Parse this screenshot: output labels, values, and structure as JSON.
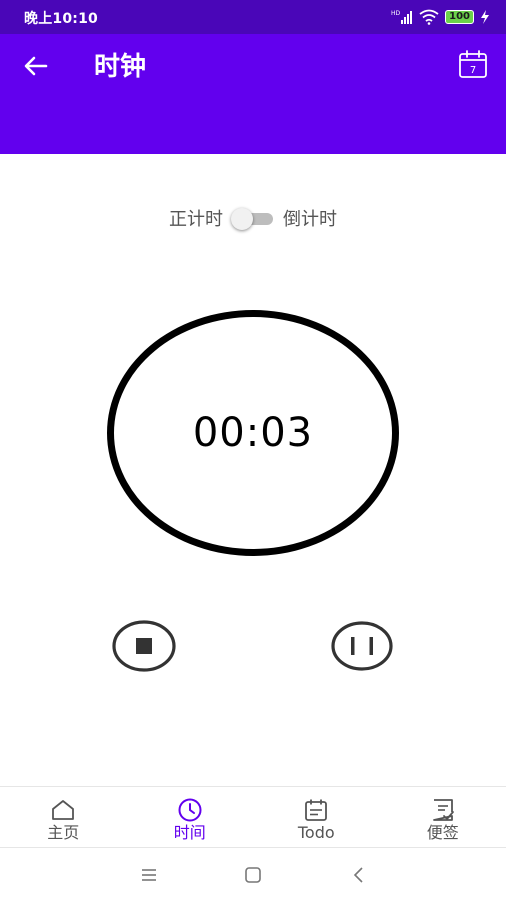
{
  "status_bar": {
    "time": "晚上10:10",
    "battery": "100",
    "icons": [
      "hd-signal-icon",
      "wifi-icon",
      "battery-icon",
      "charging-icon"
    ]
  },
  "app_bar": {
    "title": "时钟",
    "calendar_day": "7",
    "background_color": "#6200ee",
    "icons": [
      "back-arrow-icon",
      "calendar-icon"
    ]
  },
  "timer": {
    "mode_left_label": "正计时",
    "mode_right_label": "倒计时",
    "display_time": "00:03",
    "controls": [
      "stop-icon",
      "pause-icon"
    ]
  },
  "bottom_nav": {
    "active_color": "#6200ee",
    "items": [
      {
        "label": "主页",
        "icon": "home-icon"
      },
      {
        "label": "时间",
        "icon": "clock-icon"
      },
      {
        "label": "Todo",
        "icon": "calendar-list-icon"
      },
      {
        "label": "便签",
        "icon": "note-check-icon"
      }
    ]
  },
  "system_nav": {
    "icons": [
      "menu-icon",
      "home-square-icon",
      "back-chevron-icon"
    ]
  }
}
